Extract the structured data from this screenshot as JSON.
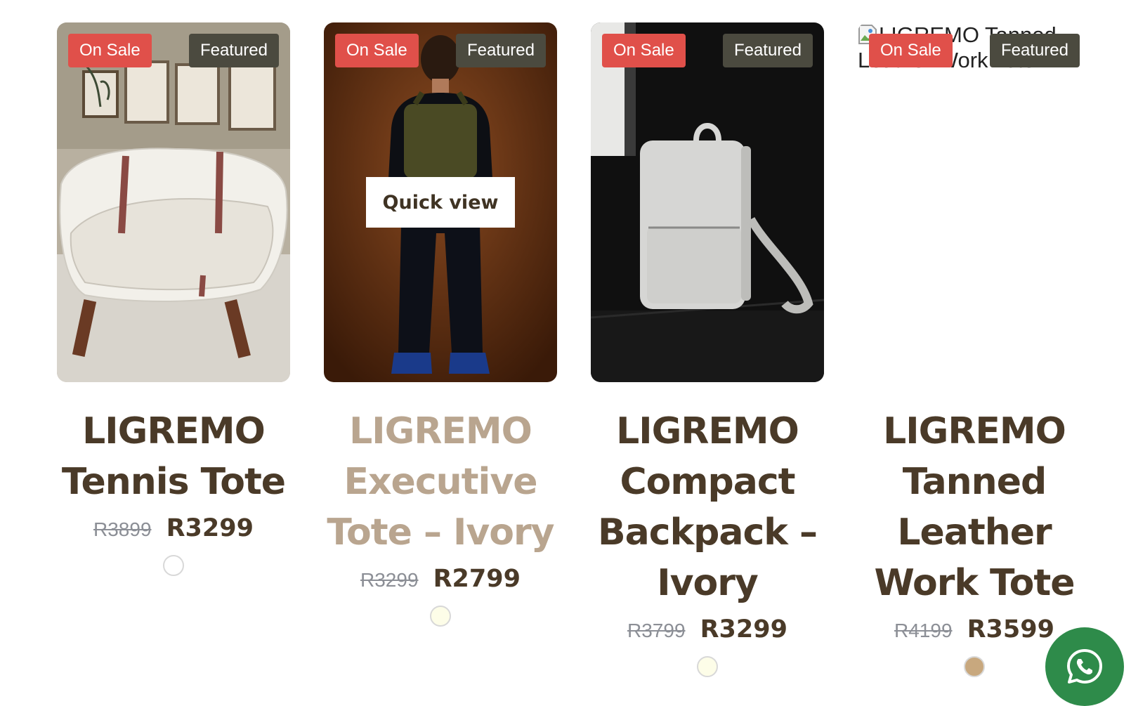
{
  "products": [
    {
      "name_line1": "LIGREMO",
      "name_line2": "Tennis Tote",
      "badge_sale": "On Sale",
      "badge_featured": "Featured",
      "price_old": "R3899",
      "price_new": "R3299",
      "swatch_color": "#ffffff"
    },
    {
      "name_line1": "LIGREMO",
      "name_line2": "Executive",
      "name_line3": "Tote – Ivory",
      "badge_sale": "On Sale",
      "badge_featured": "Featured",
      "quick_view": "Quick view",
      "price_old": "R3299",
      "price_new": "R2799",
      "swatch_color": "#fdfde8"
    },
    {
      "name_line1": "LIGREMO",
      "name_line2": "Compact",
      "name_line3": "Backpack –",
      "name_line4": "Ivory",
      "badge_sale": "On Sale",
      "badge_featured": "Featured",
      "price_old": "R3799",
      "price_new": "R3299",
      "swatch_color": "#fdfde8"
    },
    {
      "name_line1": "LIGREMO",
      "name_line2": "Tanned",
      "name_line3": "Leather",
      "name_line4": "Work Tote",
      "badge_sale": "On Sale",
      "badge_featured": "Featured",
      "image_alt": "LIGREMO Tanned Leather Work Tote",
      "price_old": "R4199",
      "price_new": "R3599",
      "swatch_color": "#c8a87e"
    }
  ],
  "colors": {
    "sale_badge": "#e0504a",
    "featured_badge": "#4b4a3f",
    "title": "#4a3a28",
    "whatsapp": "#2e8b4a"
  },
  "floating": {
    "icon": "whatsapp-icon"
  }
}
